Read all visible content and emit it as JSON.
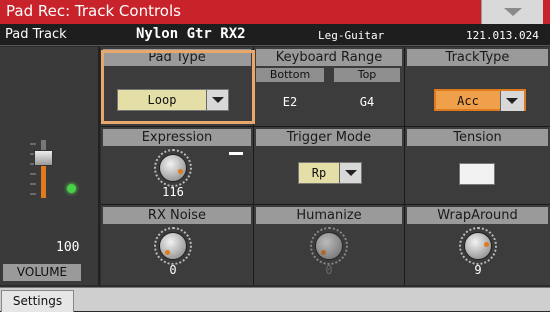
{
  "title": "Pad Rec: Track Controls",
  "header": {
    "pad_track_label": "Pad Track",
    "sound_name": "Nylon Gtr RX2",
    "category": "Leg-Guitar",
    "program_number": "121.013.024"
  },
  "cells": {
    "pad_type": {
      "label": "Pad Type",
      "value": "Loop"
    },
    "keyboard_range": {
      "label": "Keyboard Range",
      "bottom_label": "Bottom",
      "top_label": "Top",
      "bottom_value": "E2",
      "top_value": "G4"
    },
    "track_type": {
      "label": "TrackType",
      "value": "Acc"
    },
    "expression": {
      "label": "Expression",
      "value": "116"
    },
    "trigger_mode": {
      "label": "Trigger Mode",
      "value": "Rp"
    },
    "tension": {
      "label": "Tension"
    },
    "rx_noise": {
      "label": "RX Noise",
      "value": "0"
    },
    "humanize": {
      "label": "Humanize",
      "value": "0"
    },
    "wrap_around": {
      "label": "WrapAround",
      "value": "9"
    }
  },
  "volume": {
    "value": "100",
    "label": "VOLUME"
  },
  "tabs": [
    {
      "label": "Settings",
      "selected": true
    }
  ],
  "colors": {
    "title_bar": "#c8232a",
    "selection": "#e8a86b",
    "accent": "#e07a1f",
    "led": "#4ad14a"
  }
}
